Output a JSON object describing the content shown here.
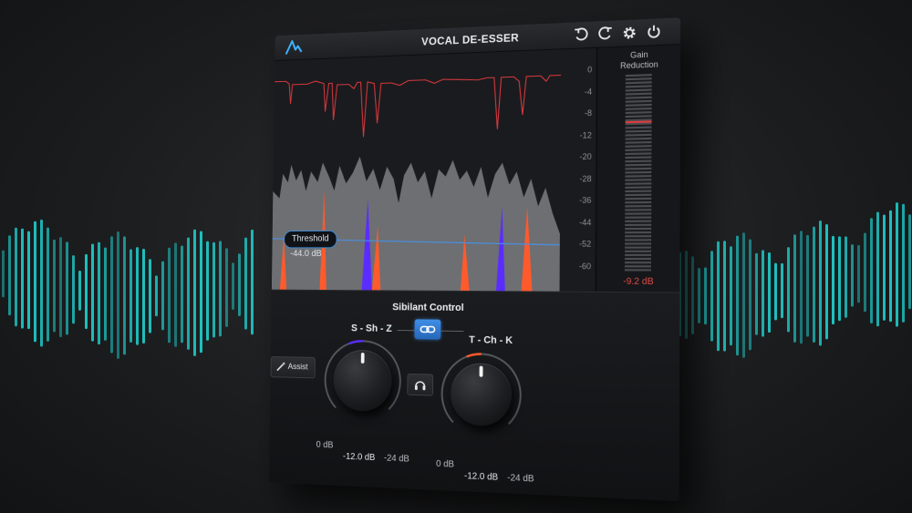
{
  "app": {
    "title": "VOCAL DE-ESSER",
    "icons": [
      "logo-icon",
      "undo-icon",
      "redo-icon",
      "gear-icon",
      "power-icon"
    ]
  },
  "display": {
    "threshold_label": "Threshold",
    "threshold_value": "-44.0 dB",
    "scale_labels": [
      "0",
      "-4",
      "-8",
      "-12",
      "-20",
      "-28",
      "-36",
      "-44",
      "-52",
      "-60"
    ]
  },
  "gain_reduction": {
    "title_line1": "Gain",
    "title_line2": "Reduction",
    "value": "-9.2 dB"
  },
  "controls": {
    "section_title": "Sibilant Control",
    "assist_label": "Assist",
    "band1": {
      "label": "S - Sh - Z",
      "value": "-12.0 dB",
      "min": "0 dB",
      "max": "-24 dB",
      "fraction": 0.5
    },
    "band2": {
      "label": "T - Ch - K",
      "value": "-12.0 dB",
      "min": "0 dB",
      "max": "-24 dB",
      "fraction": 0.5
    }
  },
  "colors": {
    "accent_blue": "#3f8fe6",
    "sibilance_red": "#ff5a2c",
    "sibilance_violet": "#5b2cff",
    "background_bars": "#1fc8c6",
    "gain_reduction_red": "#e24a4a"
  }
}
